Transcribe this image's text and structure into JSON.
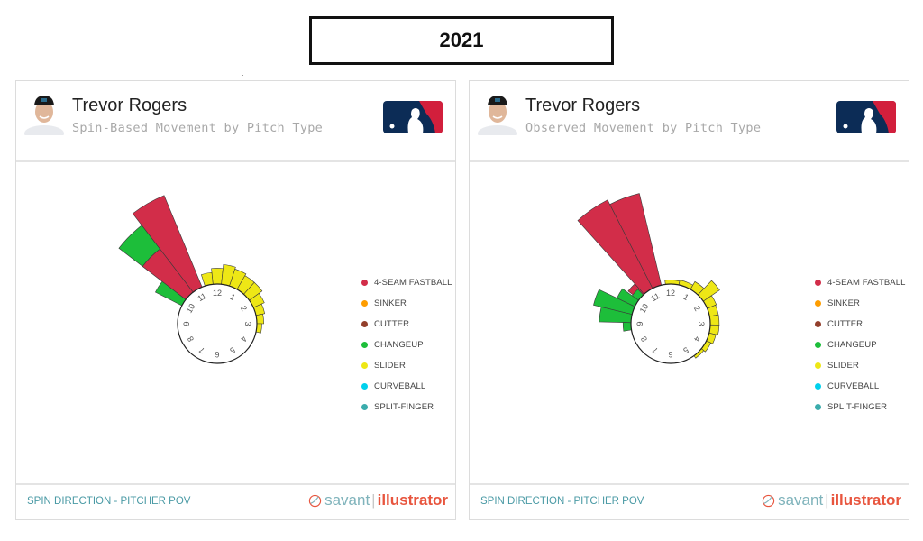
{
  "header": {
    "year": "2021"
  },
  "legend": [
    {
      "label": "4-SEAM FASTBALL",
      "color": "#d22d49"
    },
    {
      "label": "SINKER",
      "color": "#fe9d00"
    },
    {
      "label": "CUTTER",
      "color": "#933f2c"
    },
    {
      "label": "CHANGEUP",
      "color": "#1dbe3a"
    },
    {
      "label": "SLIDER",
      "color": "#eee716"
    },
    {
      "label": "CURVEBALL",
      "color": "#00d1ed"
    },
    {
      "label": "SPLIT-FINGER",
      "color": "#3bacac"
    }
  ],
  "panels": [
    {
      "player_name": "Trevor Rogers",
      "subtitle": "Spin-Based Movement by Pitch Type",
      "footer_label": "SPIN DIRECTION - PITCHER POV",
      "brand_savant": "savant",
      "brand_sep": "|",
      "brand_illustrator": "illustrator"
    },
    {
      "player_name": "Trevor Rogers",
      "subtitle": "Observed Movement by Pitch Type",
      "footer_label": "SPIN DIRECTION - PITCHER POV",
      "brand_savant": "savant",
      "brand_sep": "|",
      "brand_illustrator": "illustrator"
    }
  ],
  "chart_data": [
    {
      "type": "radial-bar",
      "title": "Spin-Based Movement by Pitch Type",
      "axis": "clock (spin direction, pitcher POV)",
      "tick_labels": [
        "12",
        "1",
        "2",
        "3",
        "4",
        "5",
        "6",
        "7",
        "8",
        "9",
        "10",
        "11"
      ],
      "series": [
        {
          "name": "4-SEAM FASTBALL",
          "color": "#d22d49",
          "bins": [
            {
              "start": 10.75,
              "end": 11.25,
              "value": 100
            },
            {
              "start": 10.25,
              "end": 10.75,
              "value": 55
            }
          ]
        },
        {
          "name": "CHANGEUP",
          "color": "#1dbe3a",
          "bins": [
            {
              "start": 10.25,
              "end": 10.75,
              "value": 85,
              "base": 55
            },
            {
              "start": 9.9,
              "end": 10.25,
              "value": 30
            }
          ]
        },
        {
          "name": "SLIDER",
          "color": "#eee716",
          "bins": [
            {
              "start": 11.4,
              "end": 11.8,
              "value": 12
            },
            {
              "start": 11.8,
              "end": 12.2,
              "value": 16
            },
            {
              "start": 12.2,
              "end": 12.6,
              "value": 20
            },
            {
              "start": 12.6,
              "end": 1.0,
              "value": 18
            },
            {
              "start": 1.0,
              "end": 1.4,
              "value": 16
            },
            {
              "start": 1.4,
              "end": 1.8,
              "value": 16
            },
            {
              "start": 1.8,
              "end": 2.2,
              "value": 12
            },
            {
              "start": 2.2,
              "end": 2.6,
              "value": 9
            },
            {
              "start": 2.6,
              "end": 3.0,
              "value": 7
            },
            {
              "start": 3.0,
              "end": 3.4,
              "value": 5
            }
          ]
        }
      ]
    },
    {
      "type": "radial-bar",
      "title": "Observed Movement by Pitch Type",
      "axis": "clock (spin direction, pitcher POV)",
      "tick_labels": [
        "12",
        "1",
        "2",
        "3",
        "4",
        "5",
        "6",
        "7",
        "8",
        "9",
        "10",
        "11"
      ],
      "series": [
        {
          "name": "4-SEAM FASTBALL",
          "color": "#d22d49",
          "bins": [
            {
              "start": 10.6,
              "end": 11.1,
              "value": 100
            },
            {
              "start": 11.1,
              "end": 11.55,
              "value": 95
            },
            {
              "start": 10.25,
              "end": 10.6,
              "value": 14
            }
          ]
        },
        {
          "name": "CHANGEUP",
          "color": "#1dbe3a",
          "bins": [
            {
              "start": 10.2,
              "end": 10.55,
              "value": 8
            },
            {
              "start": 9.85,
              "end": 10.2,
              "value": 20
            },
            {
              "start": 9.45,
              "end": 9.85,
              "value": 40
            },
            {
              "start": 9.05,
              "end": 9.45,
              "value": 32
            },
            {
              "start": 8.7,
              "end": 9.05,
              "value": 8
            }
          ]
        },
        {
          "name": "SLIDER",
          "color": "#eee716",
          "bins": [
            {
              "start": 11.75,
              "end": 12.4,
              "value": 4
            },
            {
              "start": 12.4,
              "end": 1.0,
              "value": 5
            },
            {
              "start": 1.0,
              "end": 1.45,
              "value": 9
            },
            {
              "start": 1.45,
              "end": 1.85,
              "value": 20
            },
            {
              "start": 1.85,
              "end": 2.25,
              "value": 10
            },
            {
              "start": 2.25,
              "end": 2.65,
              "value": 9
            },
            {
              "start": 2.65,
              "end": 3.05,
              "value": 9
            },
            {
              "start": 3.05,
              "end": 3.45,
              "value": 9
            },
            {
              "start": 3.45,
              "end": 3.85,
              "value": 7
            },
            {
              "start": 3.85,
              "end": 4.3,
              "value": 5
            },
            {
              "start": 4.3,
              "end": 4.8,
              "value": 3
            }
          ]
        }
      ]
    }
  ]
}
